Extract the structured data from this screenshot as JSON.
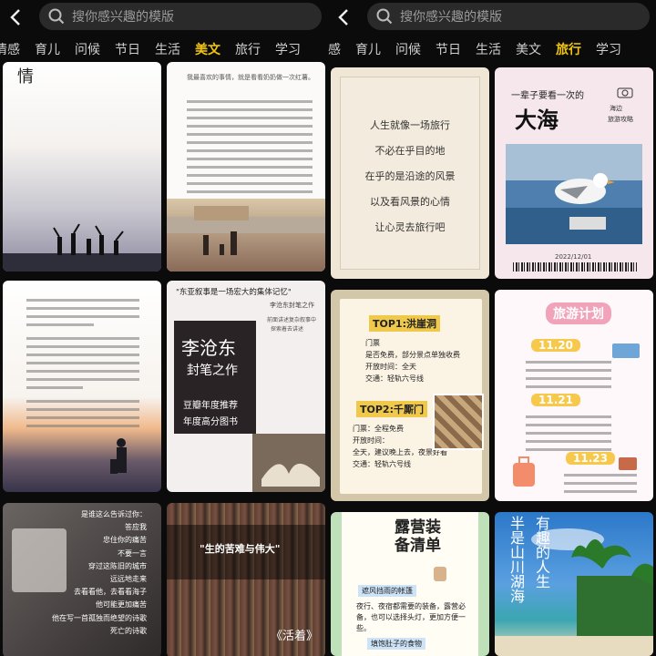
{
  "left": {
    "search_placeholder": "搜你感兴趣的模版",
    "tabs": [
      "情感",
      "育儿",
      "问候",
      "节日",
      "生活",
      "美文",
      "旅行",
      "学习"
    ],
    "active_tab": "美文",
    "cards": {
      "c1_text": "情",
      "c2_text": "我最喜欢的事情，就是看看奶奶做一次红薯。",
      "c4_quote": "\"东亚叙事是一场宏大的集体记忆\"",
      "c4_sub1": "李沧东封笔之作",
      "c4_sub2": "前面讲述复杂叙事中",
      "c4_sub3": "探索着去讲述",
      "c4_title1": "李沧东",
      "c4_title2": "封笔之作",
      "c4_line1": "豆瓣年度推荐",
      "c4_line2": "年度高分图书",
      "c5_lines": [
        "是谁这么告诉过你：",
        "答应我",
        "忠住你的痛苦",
        "不要一言",
        "穿过这陈旧的城市",
        "远远地走来",
        "去看看他，去看看海子",
        "他可能更加痛苦",
        "他在写一首孤独而绝望的诗歌",
        "死亡的诗歌"
      ],
      "c6_quote": "\"生的苦难与伟大\"",
      "c6_book": "《活着》"
    }
  },
  "right": {
    "search_placeholder": "搜你感兴趣的模版",
    "tabs": [
      "感",
      "育儿",
      "问候",
      "节日",
      "生活",
      "美文",
      "旅行",
      "学习"
    ],
    "active_tab": "旅行",
    "cards": {
      "r1_lines": [
        "人生就像一场旅行",
        "不必在乎目的地",
        "在乎的是沿途的风景",
        "以及看风景的心情",
        "让心灵去旅行吧"
      ],
      "r2_sub": "一辈子要看一次的",
      "r2_title": "大海",
      "r2_tag1": "海边",
      "r2_tag2": "旅游攻略",
      "r2_date": "2022/12/01",
      "r3_top1": "TOP1:洪崖洞",
      "r3_top1_lines": [
        "门票",
        "是否免费，部分景点单独收费",
        "开放时间：全天",
        "交通：轻轨六号线"
      ],
      "r3_top2": "TOP2:千厮门",
      "r3_top2_lines": [
        "门票：全程免费",
        "开放时间：",
        "全天，建议晚上去，夜景好看",
        "交通：轻轨六号线"
      ],
      "r4_title": "旅游计划",
      "r4_times": [
        "11.20",
        "11.21",
        "11.23"
      ],
      "r5_title1": "露营装",
      "r5_title2": "备清单",
      "r5_label1": "遮风挡雨的帐篷",
      "r5_desc": "夜行、夜宿都需要的装备，露营必备，也可以选择头灯，更加方便一些。",
      "r5_label2": "填饱肚子的食物",
      "r6_title1": "有趣的人生",
      "r6_title2": "半是山川湖海"
    }
  }
}
